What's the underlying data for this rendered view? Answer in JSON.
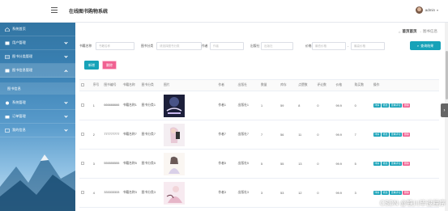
{
  "header": {
    "app_title": "在线图书购物系统",
    "user_name": "admin",
    "user_caret": "▾"
  },
  "sidebar": {
    "items": [
      {
        "label": "系统首页",
        "icon": "home-icon"
      },
      {
        "label": "用户管理",
        "icon": "user-icon"
      },
      {
        "label": "图书分类管理",
        "icon": "grid-icon"
      },
      {
        "label": "图书信息管理",
        "icon": "book-icon"
      },
      {
        "label": "图书信息",
        "icon": ""
      },
      {
        "label": "系统管理",
        "icon": "gear-icon"
      },
      {
        "label": "订单管理",
        "icon": "order-icon"
      },
      {
        "label": "我的信息",
        "icon": "profile-icon"
      }
    ]
  },
  "breadcrumb": {
    "home": "首页首页",
    "sep": "-",
    "current": "图书信息"
  },
  "filters": [
    {
      "label": "书籍名称",
      "placeholder": "书籍名称"
    },
    {
      "label": "图书分类",
      "placeholder": "请选择图书分类"
    },
    {
      "label": "作者",
      "placeholder": "作者"
    },
    {
      "label": "出版社",
      "placeholder": "出版社"
    },
    {
      "label": "价格",
      "placeholder": "最低价格"
    }
  ],
  "price_max_placeholder": "最高价格",
  "search_button": "查询结果",
  "actions": {
    "new": "新增",
    "delete": "删除"
  },
  "table": {
    "headers": [
      "",
      "序号",
      "图书编号",
      "书籍名称",
      "图书分类",
      "图片",
      "作者",
      "出版社",
      "数量",
      "库存",
      "点赞数",
      "评论数",
      "价格",
      "购买数",
      "操作"
    ],
    "rows": [
      {
        "index": "1",
        "code": "666666666",
        "name": "书籍名称1",
        "category": "图书分类1",
        "author": "作者1",
        "publisher": "出版社1",
        "qty": "1",
        "stock": "59",
        "likes": "8",
        "comments": "0",
        "price": "99.9",
        "buy": "0"
      },
      {
        "index": "2",
        "code": "777777777",
        "name": "书籍名称7",
        "category": "图书分类7",
        "author": "作者7",
        "publisher": "出版社7",
        "qty": "7",
        "stock": "56",
        "likes": "11",
        "comments": "0",
        "price": "99.9",
        "buy": "7"
      },
      {
        "index": "3",
        "code": "555555555",
        "name": "书籍名称5",
        "category": "图书分类5",
        "author": "作者5",
        "publisher": "出版社5",
        "qty": "5",
        "stock": "55",
        "likes": "13",
        "comments": "0",
        "price": "99.9",
        "buy": "5"
      },
      {
        "index": "4",
        "code": "333333333",
        "name": "书籍名称3",
        "category": "图书分类3",
        "author": "作者3",
        "publisher": "出版社3",
        "qty": "3",
        "stock": "53",
        "likes": "12",
        "comments": "0",
        "price": "99.9",
        "buy": "3"
      }
    ],
    "ops": {
      "detail": "详情",
      "edit": "修改",
      "comment": "查看评论",
      "delete": "删除"
    }
  },
  "watermark": "CSDN @铁川毕设程序",
  "colors": {
    "primary": "#17a2b8",
    "danger": "#f06292",
    "sidebar": "#3b82b5"
  }
}
